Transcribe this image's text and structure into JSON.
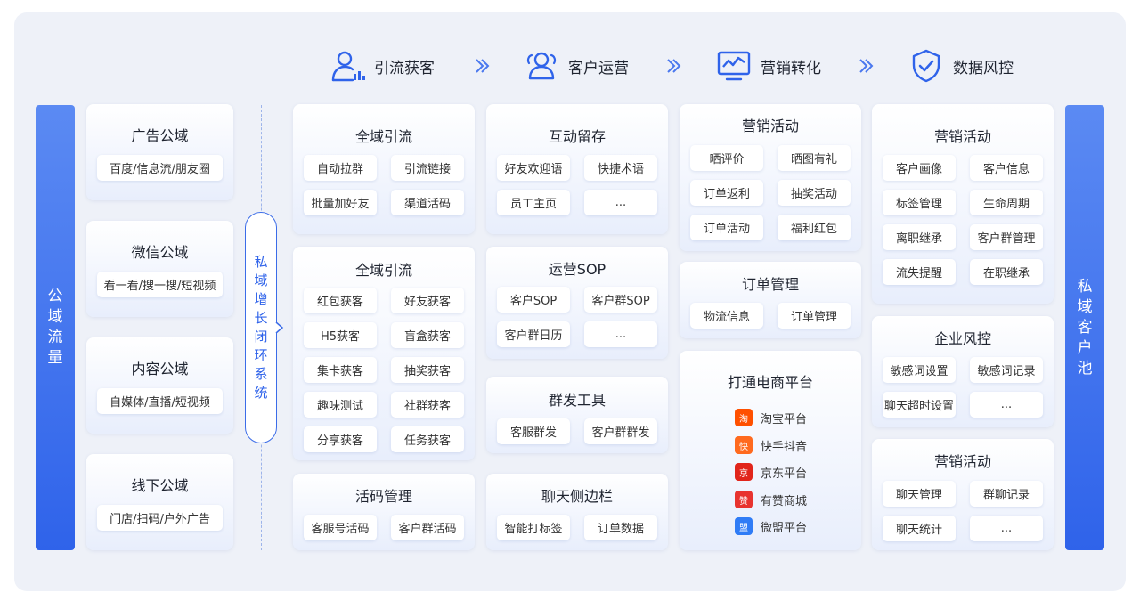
{
  "left_bar": "公域流量",
  "right_bar": "私域客户池",
  "loop_label": "私域增长闭环系统",
  "stages": [
    {
      "label": "引流获客",
      "icon": "user-chart-icon"
    },
    {
      "label": "客户运营",
      "icon": "users-icon"
    },
    {
      "label": "营销转化",
      "icon": "monitor-trend-icon"
    },
    {
      "label": "数据风控",
      "icon": "shield-check-icon"
    }
  ],
  "public_domains": [
    {
      "title": "广告公域",
      "desc": "百度/信息流/朋友圈"
    },
    {
      "title": "微信公域",
      "desc": "看一看/搜一搜/短视频"
    },
    {
      "title": "内容公域",
      "desc": "自媒体/直播/短视频"
    },
    {
      "title": "线下公域",
      "desc": "门店/扫码/户外广告"
    }
  ],
  "col1": [
    {
      "title": "全域引流",
      "tags": [
        "自动拉群",
        "引流链接",
        "批量加好友",
        "渠道活码"
      ]
    },
    {
      "title": "全域引流",
      "tags": [
        "红包获客",
        "好友获客",
        "H5获客",
        "盲盒获客",
        "集卡获客",
        "抽奖获客",
        "趣味测试",
        "社群获客",
        "分享获客",
        "任务获客"
      ]
    },
    {
      "title": "活码管理",
      "tags": [
        "客服号活码",
        "客户群活码"
      ]
    }
  ],
  "col2": [
    {
      "title": "互动留存",
      "tags": [
        "好友欢迎语",
        "快捷术语",
        "员工主页",
        "..."
      ]
    },
    {
      "title": "运营SOP",
      "tags": [
        "客户SOP",
        "客户群SOP",
        "客户群日历",
        "..."
      ]
    },
    {
      "title": "群发工具",
      "tags": [
        "客服群发",
        "客户群群发"
      ]
    },
    {
      "title": "聊天侧边栏",
      "tags": [
        "智能打标签",
        "订单数据"
      ]
    }
  ],
  "col3": [
    {
      "title": "营销活动",
      "tags": [
        "晒评价",
        "晒图有礼",
        "订单返利",
        "抽奖活动",
        "订单活动",
        "福利红包"
      ]
    },
    {
      "title": "订单管理",
      "tags": [
        "物流信息",
        "订单管理"
      ]
    },
    {
      "title": "打通电商平台",
      "platforms": [
        {
          "name": "淘宝平台",
          "icon": "taobao-icon",
          "color": "#ff5000",
          "glyph": "淘"
        },
        {
          "name": "快手抖音",
          "icon": "kuaishou-icon",
          "color": "#ff6a1f",
          "glyph": "快"
        },
        {
          "name": "京东平台",
          "icon": "jd-icon",
          "color": "#e1251b",
          "glyph": "京"
        },
        {
          "name": "有赞商城",
          "icon": "youzan-icon",
          "color": "#e8332f",
          "glyph": "赞"
        },
        {
          "name": "微盟平台",
          "icon": "weimob-icon",
          "color": "#2f7cf6",
          "glyph": "盟"
        }
      ]
    }
  ],
  "col4": [
    {
      "title": "营销活动",
      "tags": [
        "客户画像",
        "客户信息",
        "标签管理",
        "生命周期",
        "离职继承",
        "客户群管理",
        "流失提醒",
        "在职继承"
      ]
    },
    {
      "title": "企业风控",
      "tags": [
        "敏感词设置",
        "敏感词记录",
        "聊天超时设置",
        "..."
      ]
    },
    {
      "title": "营销活动",
      "tags": [
        "聊天管理",
        "群聊记录",
        "聊天统计",
        "..."
      ]
    }
  ],
  "colors": {
    "accent": "#2f63ea",
    "bar_top": "#5b8af3",
    "bg": "#eef1f8"
  }
}
